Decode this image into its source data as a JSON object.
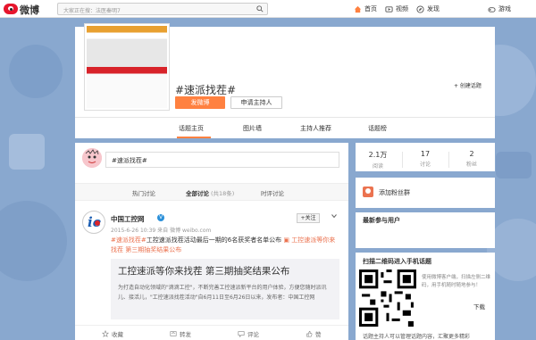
{
  "topbar": {
    "logo_text": "微博",
    "search_placeholder": "大家正在搜：法医秦明7",
    "nav": [
      {
        "icon": "home-icon",
        "label": "首页"
      },
      {
        "icon": "video-icon",
        "label": "视频"
      },
      {
        "icon": "discover-icon",
        "label": "发现"
      },
      {
        "icon": "game-icon",
        "label": "游戏"
      }
    ]
  },
  "topic": {
    "title": "#速派找茬#",
    "post_button": "发微博",
    "host_button": "申请主持人",
    "create_topic": "+ 创建话题"
  },
  "tabs": [
    "话题主页",
    "图片墙",
    "主持人推荐",
    "话题榜"
  ],
  "compose": {
    "text": "#速派找茬#"
  },
  "subtabs": [
    {
      "label": "热门讨论",
      "count": ""
    },
    {
      "label": "全部讨论",
      "count": "(共18条)"
    },
    {
      "label": "时评讨论",
      "count": ""
    }
  ],
  "post": {
    "user": "中国工控网",
    "verified_mark": "V",
    "follow": "+关注",
    "meta": "2015-6-26 10:39 来自 微博 weibo.com",
    "text_link1": "#速派找茬#",
    "text_body": "工控速派找茬活动最后一期的6名获奖者名单公布",
    "text_link2": "工控速派等你来找茬",
    "text_link3": "第三期抽奖结果公布",
    "card_title": "工控速派等你来找茬 第三期抽奖结果公布",
    "card_desc": "为打造自动化领域的\"滴滴工控\"，不断完善工控速派新平台的用户体验，方便您随时派讯儿、接活儿，\"工控速派找茬活动\"自6月11日至6月26日以来，发布者：中国工控网",
    "actions": [
      {
        "icon": "star-icon",
        "label": "收藏"
      },
      {
        "icon": "repost-icon",
        "label": "转发"
      },
      {
        "icon": "comment-icon",
        "label": "评论"
      },
      {
        "icon": "like-icon",
        "label": "赞"
      }
    ]
  },
  "stats": [
    {
      "num": "2.1万",
      "label": "阅读"
    },
    {
      "num": "17",
      "label": "讨论"
    },
    {
      "num": "2",
      "label": "粉丝"
    }
  ],
  "sidebar": {
    "fansgroup": "添加粉丝群",
    "recent_users_title": "最新参与用户",
    "qr_title": "扫描二维码进入手机话题",
    "qr_desc": "使用微博客户端，扫描左侧二维码，用手机随时随地参与！",
    "download": "下载",
    "last_line": "话题主持人可以管理话题内容，汇聚更多精彩"
  },
  "colors": {
    "accent": "#ff8140",
    "link": "#eb7350",
    "brand": "#e6162d"
  }
}
